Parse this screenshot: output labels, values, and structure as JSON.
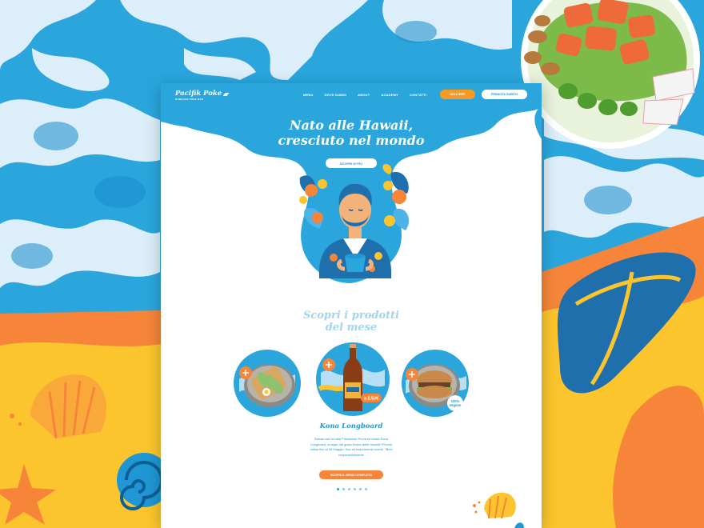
{
  "brand": {
    "name": "Pacifik Poke",
    "tagline": "HAWAIIAN POKE BAR"
  },
  "nav": {
    "links": [
      "MENU",
      "DOVE SIAMO",
      "ABOUT",
      "ACADEMY",
      "CONTATTI"
    ],
    "delivery_label": "DELIVERY",
    "book_label": "PRENOTA SUBITO"
  },
  "hero": {
    "title_line1": "Nato alle Hawaii,",
    "title_line2": "cresciuto nel mondo",
    "cta_label": "SCOPRI DI PIÙ"
  },
  "products": {
    "title_line1": "Scopri i prodotti",
    "title_line2": "del mese",
    "featured_name": "Kona Longboard",
    "price_badge": "a 2,50€",
    "vegan_badge_line1": "100%",
    "vegan_badge_line2": "Vegano",
    "description": "Brinda con noi alla Primavera! Prova la nostra Kona Longboard, la lager dal gusto fresco delle Hawaii! *Promo valida fino al 26 Maggio, fino ad esaurimento scorte. *Bevi responsabilmente",
    "menu_button_label": "SCOPRI IL MENU COMPLETO",
    "carousel_count": 6,
    "carousel_active_index": 0
  },
  "colors": {
    "sky_blue": "#2aa6dd",
    "brand_blue": "#1f97d4",
    "orange": "#f6853a",
    "yellow": "#fcc52d",
    "pale_blue": "#cfe9f7"
  }
}
